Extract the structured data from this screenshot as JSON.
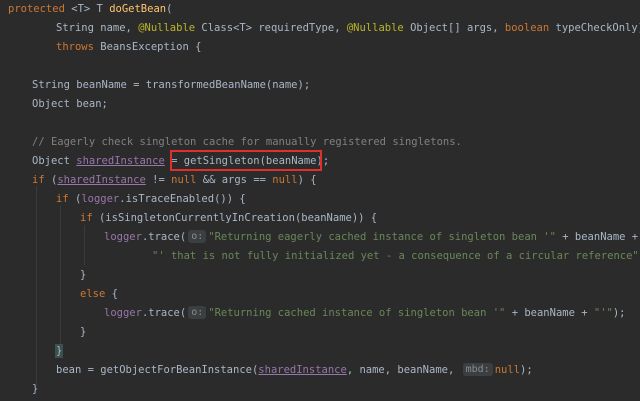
{
  "code": {
    "l1": {
      "kw": "protected",
      "gen_open": " <",
      "t": "T",
      "gen_close": "> ",
      "t2": "T ",
      "name": "doGetBean",
      "rest": "("
    },
    "l2": {
      "a": "String name, ",
      "ann1": "@Nullable",
      "b": " Class<",
      "t": "T",
      "c": "> requiredType, ",
      "ann2": "@Nullable",
      "d": " Object[] args, ",
      "kw": "boolean",
      "e": " typeCheckOnly)"
    },
    "l3": {
      "kw": "throws",
      "rest": " BeansException {"
    },
    "l4": {
      "text": "String beanName = transformedBeanName(name);"
    },
    "l5": {
      "text": "Object bean;"
    },
    "l6": {
      "comment": "// Eagerly check singleton cache for manually registered singletons."
    },
    "l7": {
      "a": "Object ",
      "var": "sharedInstance",
      "b": " = ",
      "call": "getSingleton(beanName);"
    },
    "l8": {
      "kw": "if",
      "a": " (",
      "var": "sharedInstance",
      "b": " != ",
      "kw2": "null",
      "c": " && args == ",
      "kw3": "null",
      "d": ") {"
    },
    "l9": {
      "kw": "if",
      "a": " (",
      "fld": "logger",
      "b": ".isTraceEnabled()) {"
    },
    "l10": {
      "kw": "if",
      "rest": " (isSingletonCurrentlyInCreation(beanName)) {"
    },
    "l11": {
      "fld": "logger",
      "a": ".trace(",
      "hint": "o:",
      "str": "\"Returning eagerly cached instance of singleton bean '\"",
      "b": " + beanName +"
    },
    "l12": {
      "str": "\"' that is not fully initialized yet - a consequence of a circular reference\"",
      "b": ");"
    },
    "l13": {
      "text": "}"
    },
    "l14": {
      "kw": "else",
      "rest": " {"
    },
    "l15": {
      "fld": "logger",
      "a": ".trace(",
      "hint": "o:",
      "str": "\"Returning cached instance of singleton bean '\"",
      "b": " + beanName + ",
      "str2": "\"'\"",
      "c": ");"
    },
    "l16": {
      "text": "}"
    },
    "l17": {
      "text": "}"
    },
    "l18": {
      "a": "bean = getObjectForBeanInstance(",
      "var": "sharedInstance",
      "b": ", name, beanName, ",
      "hint": "mbd:",
      "kw": "null",
      "c": ");"
    },
    "l19": {
      "text": "}"
    }
  },
  "colors": {
    "background": "#2b2b2b",
    "keyword": "#cc7832",
    "annotation": "#bbb529",
    "string": "#6a8759",
    "comment": "#808080",
    "field": "#9876aa",
    "highlight_box": "#e0302c"
  }
}
